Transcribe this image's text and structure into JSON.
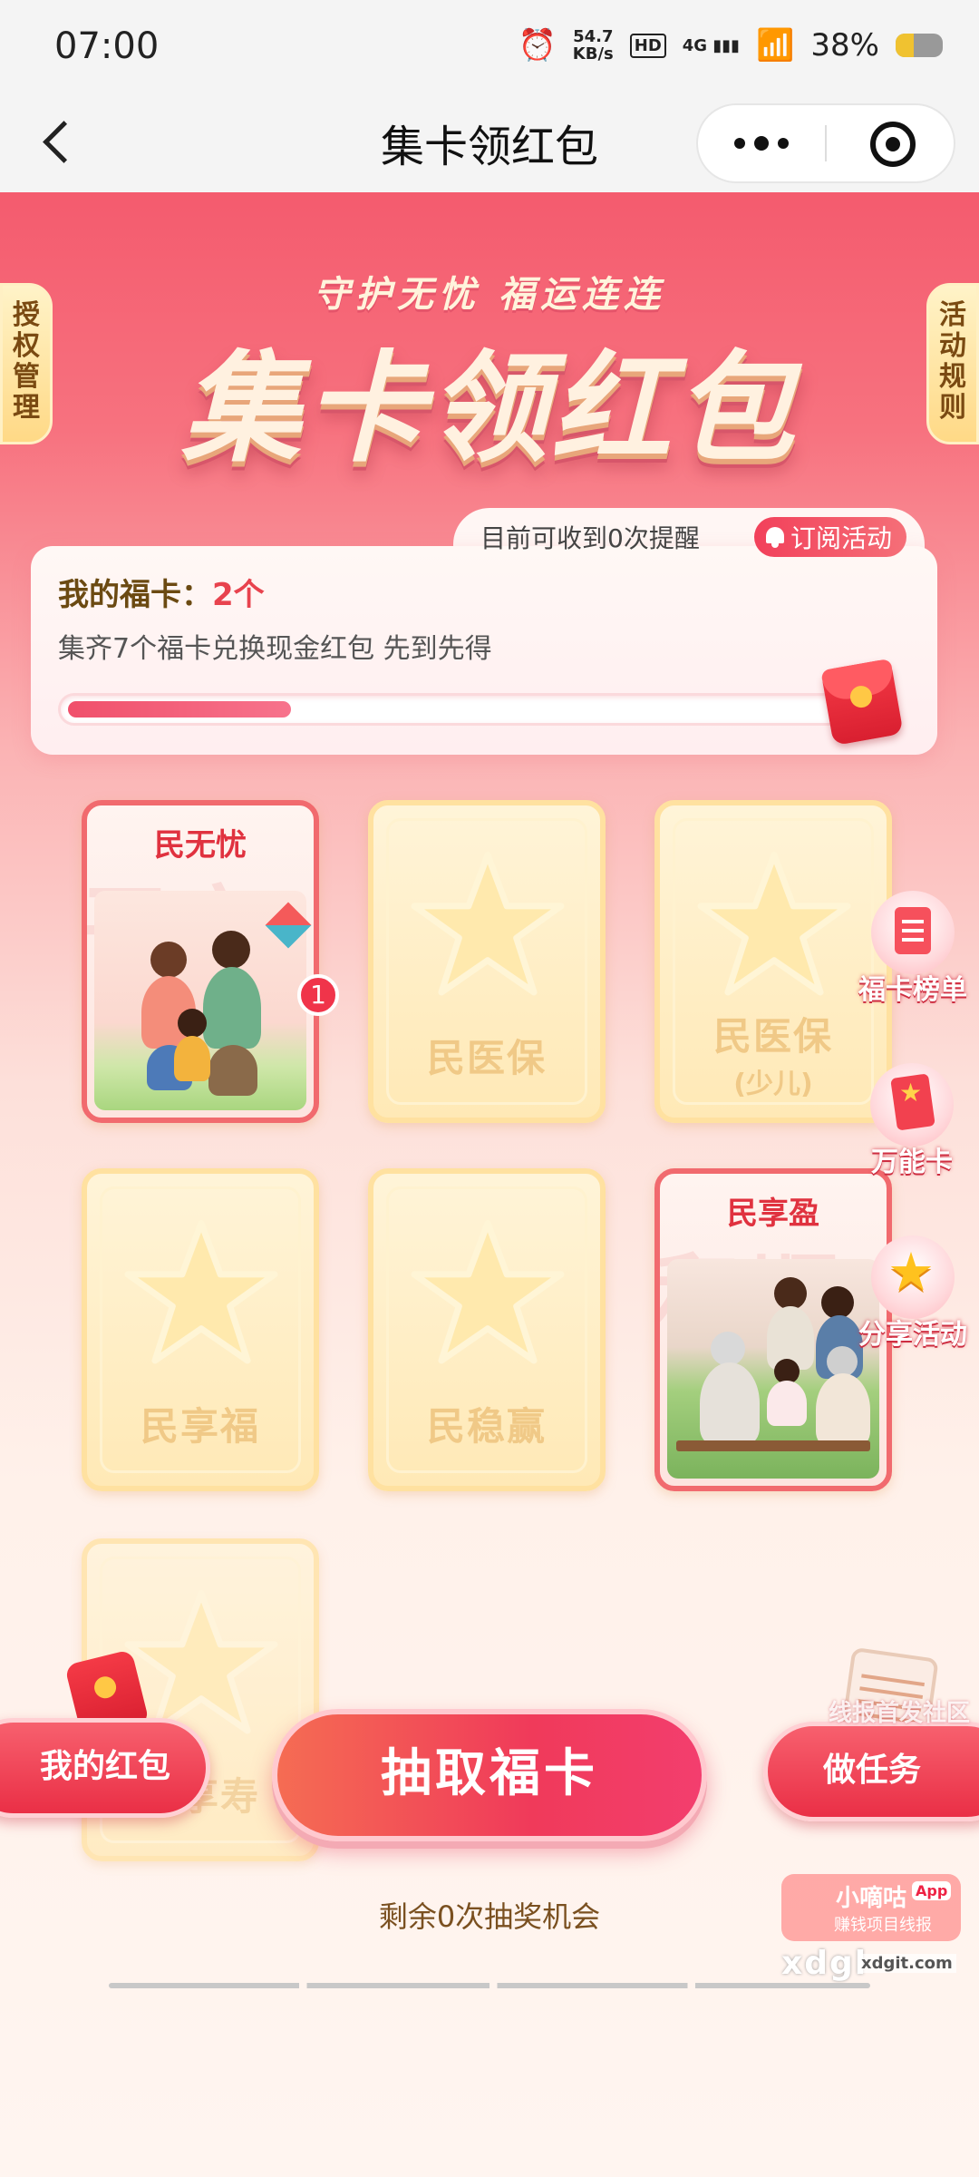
{
  "status_bar": {
    "time": "07:00",
    "net_speed_value": "54.7",
    "net_speed_unit": "KB/s",
    "hd": "HD",
    "network": "4G",
    "battery": "38%"
  },
  "nav": {
    "title": "集卡领红包"
  },
  "hero": {
    "subtitle": "守护无忧  福运连连",
    "title": "集卡领红包"
  },
  "side_tabs": {
    "left": [
      "授",
      "权",
      "管",
      "理"
    ],
    "right": [
      "活",
      "动",
      "规",
      "则"
    ]
  },
  "reminder": {
    "text": "目前可收到0次提醒",
    "subscribe_label": "订阅活动"
  },
  "progress": {
    "my_cards_label": "我的福卡：",
    "my_cards_count": "2个",
    "description": "集齐7个福卡兑换现金红包 先到先得",
    "collected": 2,
    "total": 7
  },
  "cards": [
    {
      "name": "民无忧",
      "owned": true,
      "count": "1",
      "bg_text": "平安"
    },
    {
      "name": "民医保",
      "owned": false
    },
    {
      "name": "民医保",
      "sub": "(少儿)",
      "owned": false
    },
    {
      "name": "民享福",
      "owned": false
    },
    {
      "name": "民稳赢",
      "owned": false
    },
    {
      "name": "民享盈",
      "owned": true,
      "bg_text": "和顺"
    },
    {
      "name": "民享寿",
      "owned": false
    }
  ],
  "float_buttons": {
    "ranking": "福卡榜单",
    "wildcard": "万能卡",
    "share": "分享活动"
  },
  "bottom": {
    "my_redpack": "我的红包",
    "draw": "抽取福卡",
    "task": "做任务",
    "remaining": "剩余0次抽奖机会"
  },
  "watermarks": {
    "line1": "线报首发社区",
    "brand": "小嘀咕",
    "app": "App",
    "brand_sub": "赚钱项目线报",
    "domain": "xdgl",
    "domain_small": "xdgit.com"
  },
  "colors": {
    "accent_red": "#f03a5a",
    "gold_text": "#6b4a12",
    "card_empty": "#ffe9b6"
  }
}
